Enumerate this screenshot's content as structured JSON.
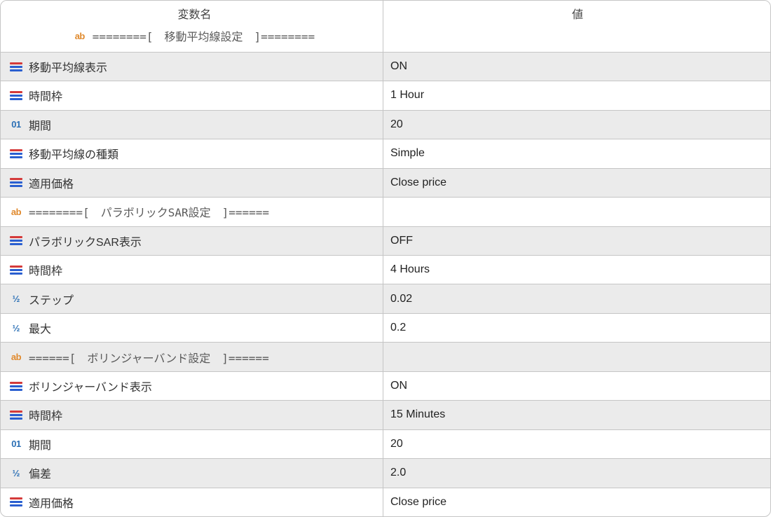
{
  "headers": {
    "name": "変数名",
    "value": "値"
  },
  "icons": {
    "ab": "ab",
    "int": "01",
    "frac": "½"
  },
  "rows": [
    {
      "type": "ab",
      "name": "========[　移動平均線設定　]========",
      "value": ""
    },
    {
      "type": "enum",
      "name": "移動平均線表示",
      "value": "ON"
    },
    {
      "type": "enum",
      "name": "時間枠",
      "value": "1 Hour"
    },
    {
      "type": "int",
      "name": "期間",
      "value": "20"
    },
    {
      "type": "enum",
      "name": "移動平均線の種類",
      "value": "Simple"
    },
    {
      "type": "enum",
      "name": "適用価格",
      "value": "Close price"
    },
    {
      "type": "ab",
      "name": "========[　パラボリックSAR設定　]======",
      "value": ""
    },
    {
      "type": "enum",
      "name": "パラボリックSAR表示",
      "value": "OFF"
    },
    {
      "type": "enum",
      "name": "時間枠",
      "value": "4 Hours"
    },
    {
      "type": "frac",
      "name": "ステップ",
      "value": "0.02"
    },
    {
      "type": "frac",
      "name": "最大",
      "value": "0.2"
    },
    {
      "type": "ab",
      "name": "======[　ボリンジャーバンド設定　]======",
      "value": ""
    },
    {
      "type": "enum",
      "name": "ボリンジャーバンド表示",
      "value": "ON"
    },
    {
      "type": "enum",
      "name": "時間枠",
      "value": "15 Minutes"
    },
    {
      "type": "int",
      "name": "期間",
      "value": "20"
    },
    {
      "type": "frac",
      "name": "偏差",
      "value": "2.0"
    },
    {
      "type": "enum",
      "name": "適用価格",
      "value": "Close price"
    }
  ]
}
